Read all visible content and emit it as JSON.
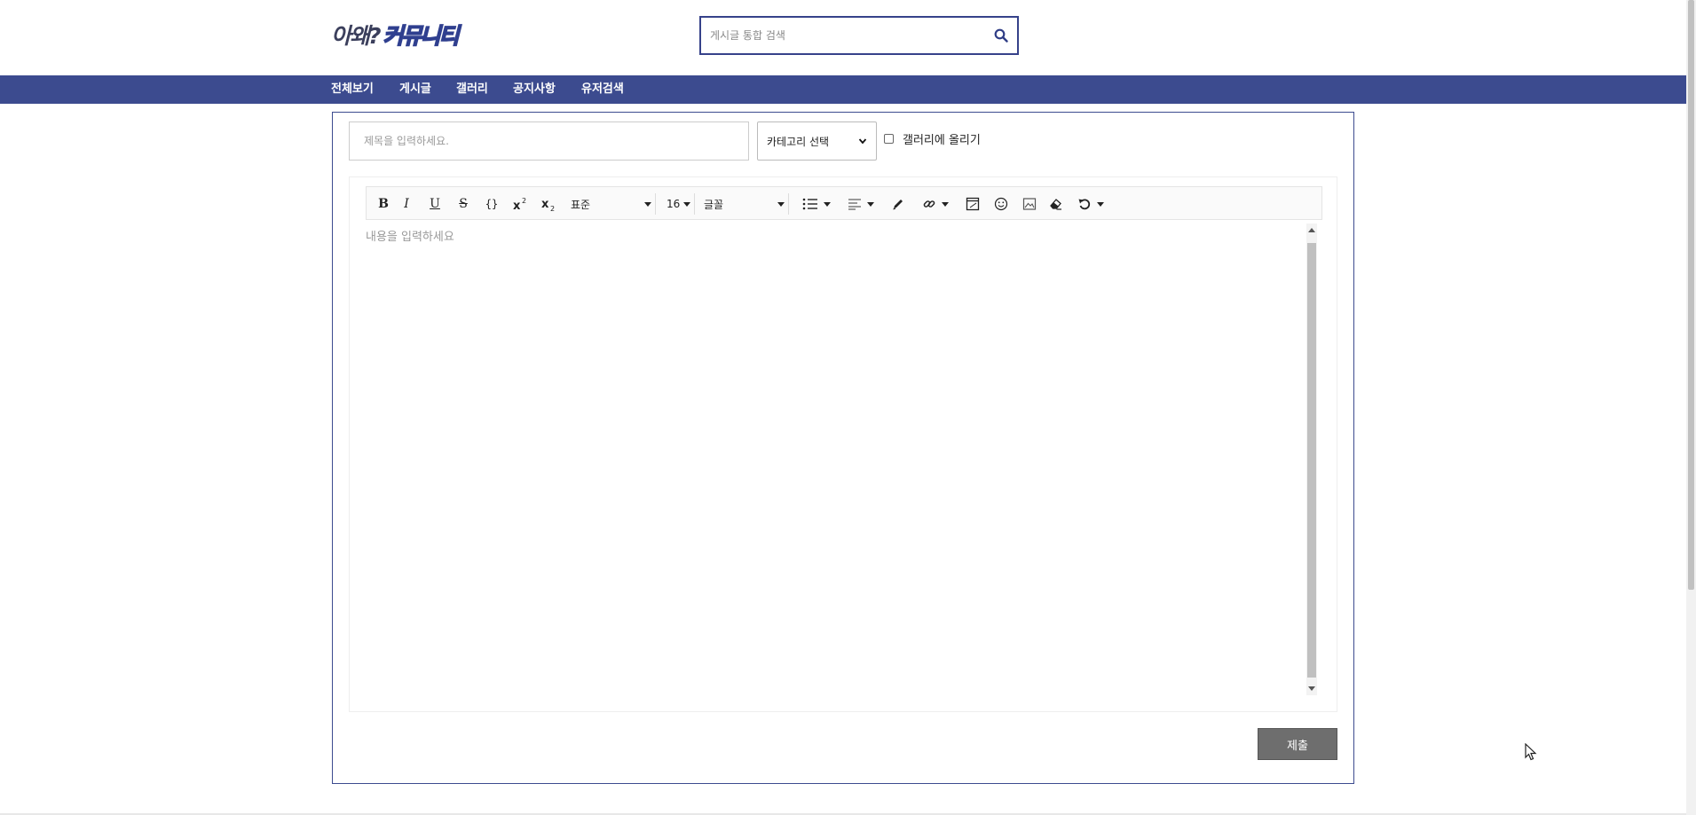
{
  "header": {
    "logo_part1": "아왜?",
    "logo_part2": "커뮤니티",
    "search_placeholder": "게시글 통합 검색"
  },
  "nav": {
    "items": [
      "전체보기",
      "게시글",
      "갤러리",
      "공지사항",
      "유저검색"
    ]
  },
  "form": {
    "title_placeholder": "제목을 입력하세요.",
    "category_selected": "카테고리 선택",
    "gallery_checkbox_label": "갤러리에 올리기",
    "gallery_checked": false,
    "submit_label": "제출"
  },
  "editor": {
    "placeholder": "내용을 입력하세요",
    "toolbar": {
      "bold": "B",
      "italic": "I",
      "underline": "U",
      "strike": "S",
      "code": "{}",
      "format_value": "표준",
      "font_size": "16",
      "font_family": "글꼴"
    }
  },
  "colors": {
    "nav_bg": "#3c4b8f",
    "search_border": "#36428a",
    "submit_bg": "#6e6e6e"
  }
}
